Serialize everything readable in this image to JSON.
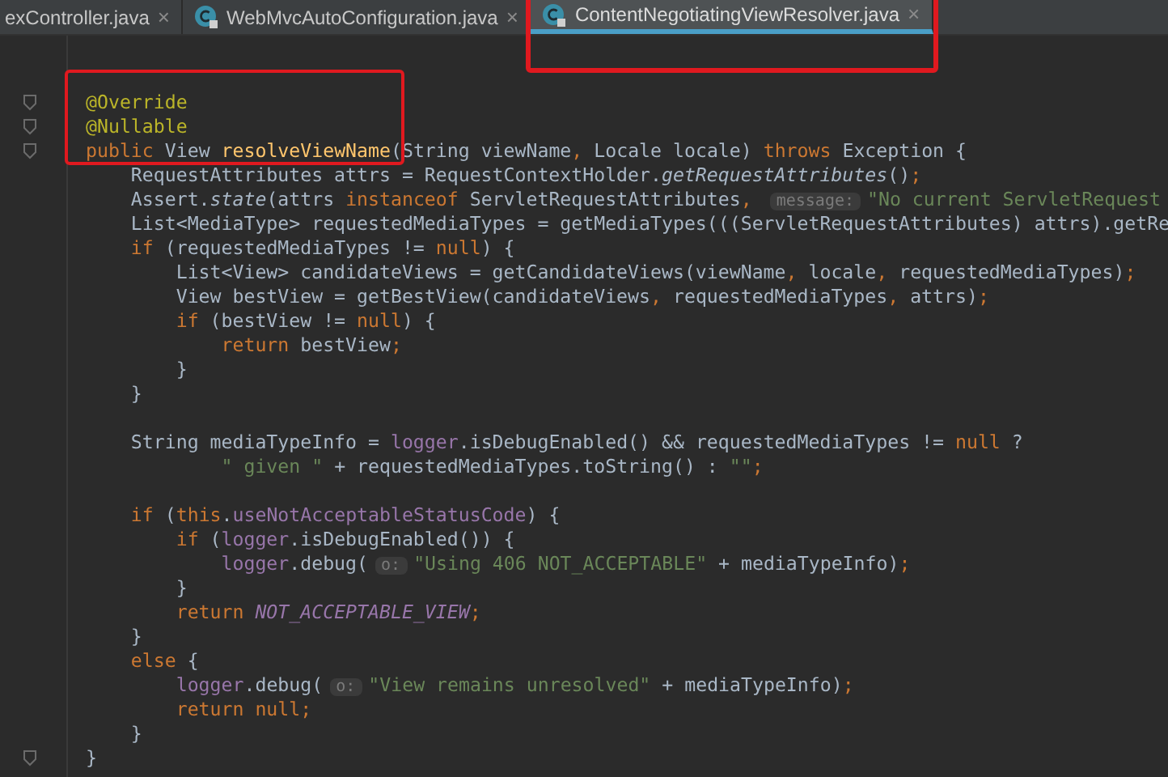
{
  "tabs": [
    {
      "label": "exController.java",
      "icon": false,
      "selected": false
    },
    {
      "label": "WebMvcAutoConfiguration.java",
      "icon": true,
      "selected": false
    },
    {
      "label": "ContentNegotiatingViewResolver.java",
      "icon": true,
      "selected": true
    }
  ],
  "tab_close": "×",
  "highlight_frames": {
    "around_method_header": true,
    "around_active_tab": true
  },
  "lines": [
    {
      "fold": true,
      "tokens": [
        {
          "kind": "annotation",
          "text": "@Override"
        }
      ]
    },
    {
      "fold": true,
      "tokens": [
        {
          "kind": "annotation",
          "text": "@Nullable"
        }
      ]
    },
    {
      "fold": true,
      "tokens": [
        {
          "kind": "keyword",
          "text": "public "
        },
        {
          "kind": "plain",
          "text": "View "
        },
        {
          "kind": "decl",
          "text": "resolveViewName"
        },
        {
          "kind": "plain",
          "text": "(String viewName"
        },
        {
          "kind": "keyword",
          "text": ", "
        },
        {
          "kind": "plain",
          "text": "Locale locale) "
        },
        {
          "kind": "keyword",
          "text": "throws "
        },
        {
          "kind": "plain",
          "text": "Exception {"
        }
      ]
    },
    {
      "fold": false,
      "tokens": [
        {
          "kind": "plain",
          "text": "    RequestAttributes attrs = RequestContextHolder."
        },
        {
          "kind": "static",
          "text": "getRequestAttributes"
        },
        {
          "kind": "plain",
          "text": "()"
        },
        {
          "kind": "keyword",
          "text": ";"
        }
      ]
    },
    {
      "fold": false,
      "tokens": [
        {
          "kind": "plain",
          "text": "    Assert."
        },
        {
          "kind": "static",
          "text": "state"
        },
        {
          "kind": "plain",
          "text": "(attrs "
        },
        {
          "kind": "keyword",
          "text": "instanceof "
        },
        {
          "kind": "plain",
          "text": "ServletRequestAttributes"
        },
        {
          "kind": "keyword",
          "text": ", "
        },
        {
          "kind": "hint",
          "text": "message:"
        },
        {
          "kind": "string",
          "text": "\"No current ServletRequest"
        }
      ]
    },
    {
      "fold": false,
      "tokens": [
        {
          "kind": "plain",
          "text": "    List<MediaType> requestedMediaTypes = getMediaTypes(((ServletRequestAttributes) attrs).getRe"
        }
      ]
    },
    {
      "fold": false,
      "tokens": [
        {
          "kind": "keyword",
          "text": "    if "
        },
        {
          "kind": "plain",
          "text": "(requestedMediaTypes != "
        },
        {
          "kind": "keyword",
          "text": "null"
        },
        {
          "kind": "plain",
          "text": ") {"
        }
      ]
    },
    {
      "fold": false,
      "tokens": [
        {
          "kind": "plain",
          "text": "        List<View> candidateViews = getCandidateViews(viewName"
        },
        {
          "kind": "keyword",
          "text": ", "
        },
        {
          "kind": "plain",
          "text": "locale"
        },
        {
          "kind": "keyword",
          "text": ", "
        },
        {
          "kind": "plain",
          "text": "requestedMediaTypes)"
        },
        {
          "kind": "keyword",
          "text": ";"
        }
      ]
    },
    {
      "fold": false,
      "tokens": [
        {
          "kind": "plain",
          "text": "        View bestView = getBestView(candidateViews"
        },
        {
          "kind": "keyword",
          "text": ", "
        },
        {
          "kind": "plain",
          "text": "requestedMediaTypes"
        },
        {
          "kind": "keyword",
          "text": ", "
        },
        {
          "kind": "plain",
          "text": "attrs)"
        },
        {
          "kind": "keyword",
          "text": ";"
        }
      ]
    },
    {
      "fold": false,
      "tokens": [
        {
          "kind": "keyword",
          "text": "        if "
        },
        {
          "kind": "plain",
          "text": "(bestView != "
        },
        {
          "kind": "keyword",
          "text": "null"
        },
        {
          "kind": "plain",
          "text": ") {"
        }
      ]
    },
    {
      "fold": false,
      "tokens": [
        {
          "kind": "keyword",
          "text": "            return "
        },
        {
          "kind": "plain",
          "text": "bestView"
        },
        {
          "kind": "keyword",
          "text": ";"
        }
      ]
    },
    {
      "fold": false,
      "tokens": [
        {
          "kind": "plain",
          "text": "        }"
        }
      ]
    },
    {
      "fold": false,
      "tokens": [
        {
          "kind": "plain",
          "text": "    }"
        }
      ]
    },
    {
      "fold": false
    },
    {
      "fold": false,
      "tokens": [
        {
          "kind": "plain",
          "text": "    String mediaTypeInfo = "
        },
        {
          "kind": "field",
          "text": "logger"
        },
        {
          "kind": "plain",
          "text": ".isDebugEnabled() && requestedMediaTypes != "
        },
        {
          "kind": "keyword",
          "text": "null "
        },
        {
          "kind": "plain",
          "text": "?"
        }
      ]
    },
    {
      "fold": false,
      "tokens": [
        {
          "kind": "string",
          "text": "            \" given \""
        },
        {
          "kind": "plain",
          "text": " + requestedMediaTypes.toString() : "
        },
        {
          "kind": "string",
          "text": "\"\""
        },
        {
          "kind": "keyword",
          "text": ";"
        }
      ]
    },
    {
      "fold": false
    },
    {
      "fold": false,
      "tokens": [
        {
          "kind": "keyword",
          "text": "    if "
        },
        {
          "kind": "plain",
          "text": "("
        },
        {
          "kind": "keyword",
          "text": "this"
        },
        {
          "kind": "plain",
          "text": "."
        },
        {
          "kind": "field",
          "text": "useNotAcceptableStatusCode"
        },
        {
          "kind": "plain",
          "text": ") {"
        }
      ]
    },
    {
      "fold": false,
      "tokens": [
        {
          "kind": "keyword",
          "text": "        if "
        },
        {
          "kind": "plain",
          "text": "("
        },
        {
          "kind": "field",
          "text": "logger"
        },
        {
          "kind": "plain",
          "text": ".isDebugEnabled()) {"
        }
      ]
    },
    {
      "fold": false,
      "tokens": [
        {
          "kind": "field",
          "text": "            logger"
        },
        {
          "kind": "plain",
          "text": ".debug("
        },
        {
          "kind": "hint",
          "text": "o:"
        },
        {
          "kind": "string",
          "text": "\"Using 406 NOT_ACCEPTABLE\""
        },
        {
          "kind": "plain",
          "text": " + mediaTypeInfo)"
        },
        {
          "kind": "keyword",
          "text": ";"
        }
      ]
    },
    {
      "fold": false,
      "tokens": [
        {
          "kind": "plain",
          "text": "        }"
        }
      ]
    },
    {
      "fold": false,
      "tokens": [
        {
          "kind": "keyword",
          "text": "        return "
        },
        {
          "kind": "constant",
          "text": "NOT_ACCEPTABLE_VIEW"
        },
        {
          "kind": "keyword",
          "text": ";"
        }
      ]
    },
    {
      "fold": false,
      "tokens": [
        {
          "kind": "plain",
          "text": "    }"
        }
      ]
    },
    {
      "fold": false,
      "tokens": [
        {
          "kind": "keyword",
          "text": "    else "
        },
        {
          "kind": "plain",
          "text": "{"
        }
      ]
    },
    {
      "fold": false,
      "tokens": [
        {
          "kind": "field",
          "text": "        logger"
        },
        {
          "kind": "plain",
          "text": ".debug("
        },
        {
          "kind": "hint",
          "text": "o:"
        },
        {
          "kind": "string",
          "text": "\"View remains unresolved\""
        },
        {
          "kind": "plain",
          "text": " + mediaTypeInfo)"
        },
        {
          "kind": "keyword",
          "text": ";"
        }
      ]
    },
    {
      "fold": false,
      "tokens": [
        {
          "kind": "keyword",
          "text": "        return null;"
        }
      ]
    },
    {
      "fold": false,
      "tokens": [
        {
          "kind": "plain",
          "text": "    }"
        }
      ]
    },
    {
      "fold": true,
      "tokens": [
        {
          "kind": "plain",
          "text": "}"
        }
      ]
    }
  ]
}
